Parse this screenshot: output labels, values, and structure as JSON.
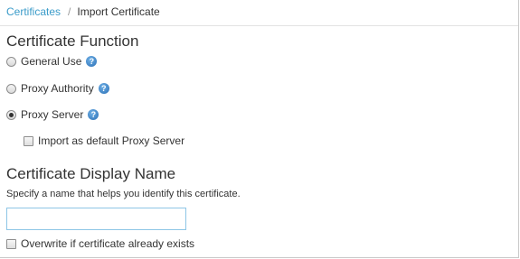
{
  "breadcrumb": {
    "parent": "Certificates",
    "separator": "/",
    "current": "Import Certificate"
  },
  "certificate_function": {
    "title": "Certificate Function",
    "options": [
      {
        "label": "General Use",
        "checked": false,
        "help_icon": "help-question-icon"
      },
      {
        "label": "Proxy Authority",
        "checked": false,
        "help_icon": "help-question-icon"
      },
      {
        "label": "Proxy Server",
        "checked": true,
        "help_icon": "help-question-icon"
      }
    ],
    "default_proxy_checkbox": {
      "label": "Import as default Proxy Server",
      "checked": false
    }
  },
  "display_name": {
    "title": "Certificate Display Name",
    "description": "Specify a name that helps you identify this certificate.",
    "input_value": "",
    "placeholder": "",
    "overwrite_checkbox": {
      "label": "Overwrite if certificate already exists",
      "checked": false
    }
  },
  "help_glyph": "?",
  "colors": {
    "link": "#3a9bc9",
    "text": "#333333",
    "input_border": "#8ec6e6",
    "help_icon": "#2a6fb5"
  }
}
